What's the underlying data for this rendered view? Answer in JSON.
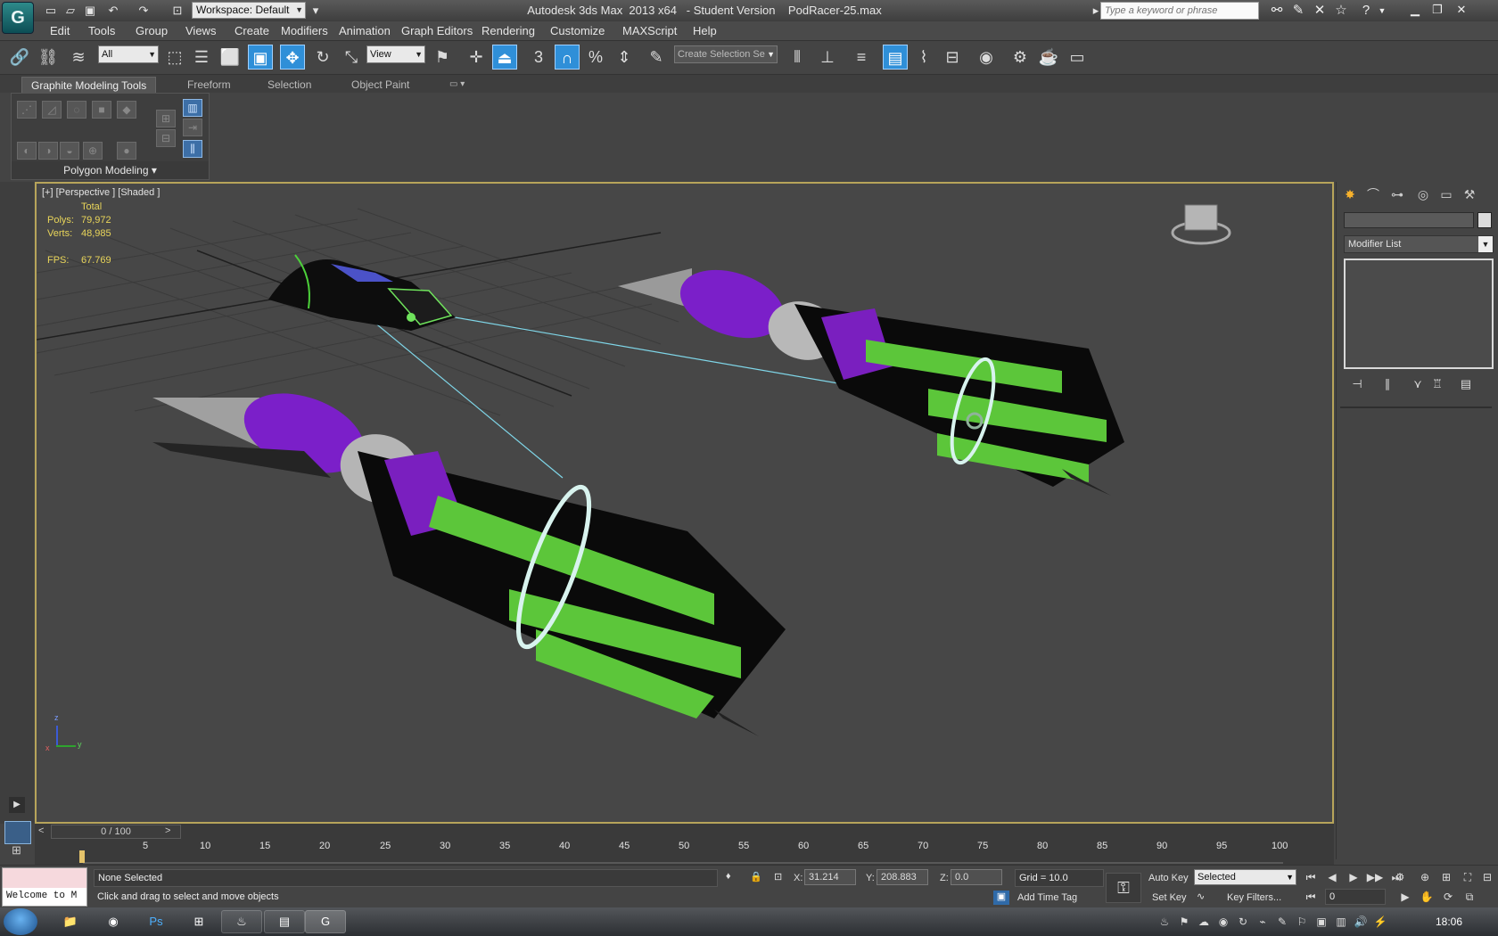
{
  "window": {
    "title": "Autodesk 3ds Max  2013 x64   - Student Version    PodRacer-25.max",
    "workspace": "Workspace: Default",
    "search_placeholder": "Type a keyword or phrase"
  },
  "menu": [
    "Edit",
    "Tools",
    "Group",
    "Views",
    "Create",
    "Modifiers",
    "Animation",
    "Graph Editors",
    "Rendering",
    "Customize",
    "MAXScript",
    "Help"
  ],
  "toolbar": {
    "selection_filter": "All",
    "reference_coord": "View",
    "snap_value": "3",
    "named_selection": "Create Selection Se"
  },
  "ribbon": {
    "tabs": [
      "Graphite Modeling Tools",
      "Freeform",
      "Selection",
      "Object Paint"
    ],
    "panel_label": "Polygon Modeling"
  },
  "viewport": {
    "label": "[+] [Perspective ] [Shaded ]",
    "stats_header": "Total",
    "polys_label": "Polys:",
    "polys_value": "79,972",
    "verts_label": "Verts:",
    "verts_value": "48,985",
    "fps_label": "FPS:",
    "fps_value": "67.769",
    "axis": {
      "z": "z",
      "x": "x",
      "y": "y"
    }
  },
  "command_panel": {
    "modifier_list": "Modifier List"
  },
  "timeline": {
    "frame_display": "0 / 100",
    "prev": "<",
    "next": ">",
    "ticks": [
      "5",
      "10",
      "15",
      "20",
      "25",
      "30",
      "35",
      "40",
      "45",
      "50",
      "55",
      "60",
      "65",
      "70",
      "75",
      "80",
      "85",
      "90",
      "95",
      "100"
    ]
  },
  "status": {
    "maxscript_text": "Welcome to M",
    "selection": "None Selected",
    "prompt": "Click and drag to select and move objects",
    "x_label": "X:",
    "x_value": "31.214",
    "y_label": "Y:",
    "y_value": "208.883",
    "z_label": "Z:",
    "z_value": "0.0",
    "grid": "Grid = 10.0",
    "add_time_tag": "Add Time Tag",
    "auto_key": "Auto Key",
    "set_key": "Set Key",
    "key_mode": "Selected",
    "key_filters": "Key Filters...",
    "current_frame": "0"
  },
  "taskbar": {
    "clock": "18:06",
    "apps": [
      "explorer",
      "chrome",
      "photoshop",
      "libraries",
      "steam",
      "winrar",
      "3dsmax"
    ]
  }
}
